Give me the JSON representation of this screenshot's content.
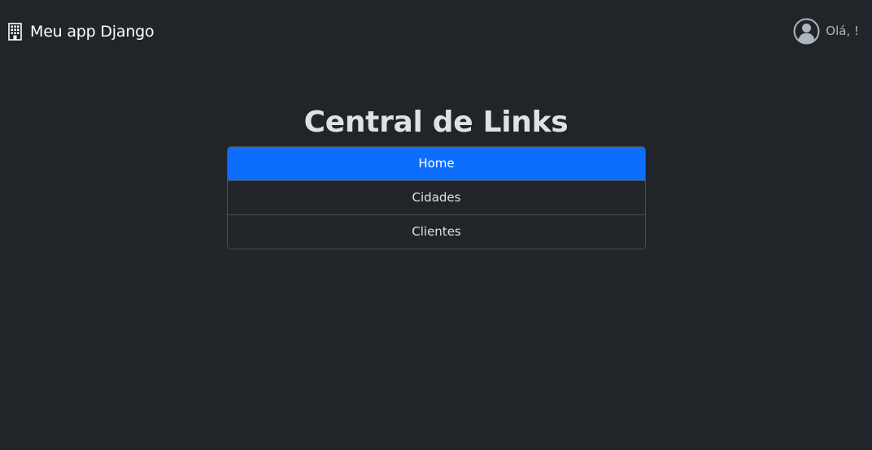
{
  "navbar": {
    "brand_icon": "building-icon",
    "brand_label": "Meu app Django",
    "user_icon": "user-circle-icon",
    "greeting": "Olá, !"
  },
  "main": {
    "title": "Central de Links",
    "links": [
      {
        "label": "Home",
        "active": true
      },
      {
        "label": "Cidades",
        "active": false
      },
      {
        "label": "Clientes",
        "active": false
      }
    ]
  },
  "colors": {
    "background": "#212529",
    "accent": "#0d6efd",
    "border": "#495057",
    "text": "#dee2e6",
    "muted": "#adb5bd"
  }
}
